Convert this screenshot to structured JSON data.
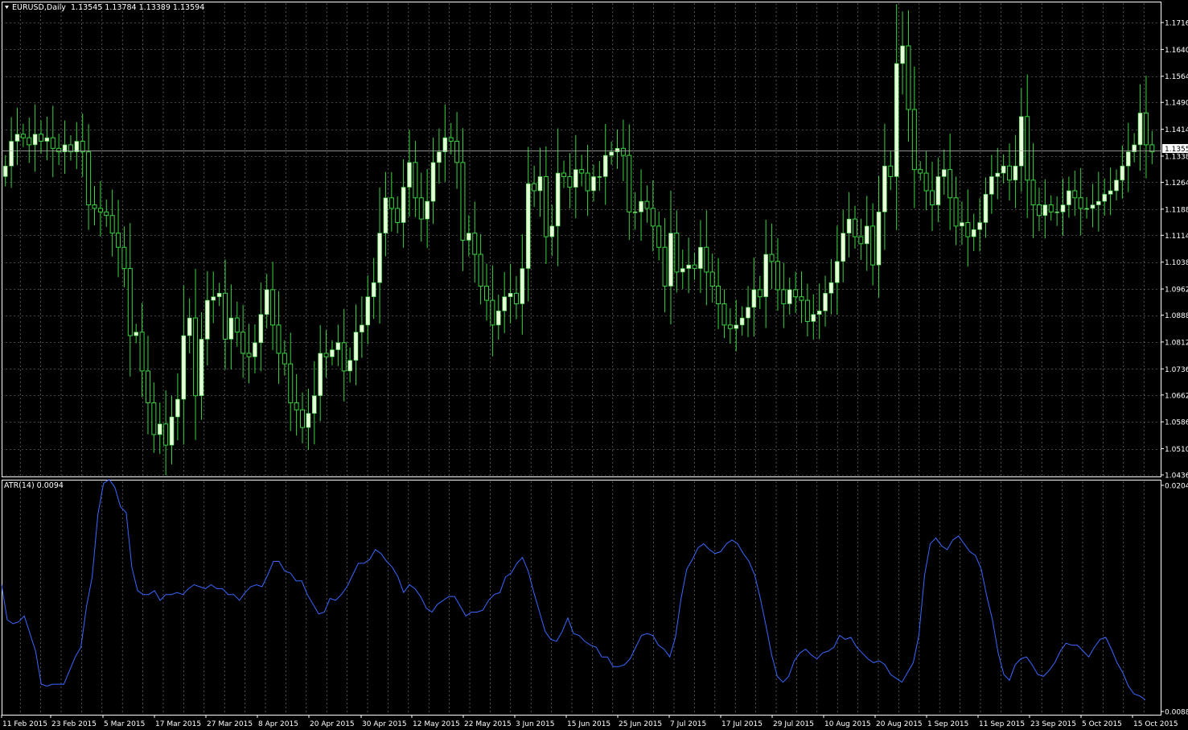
{
  "chart_data": [
    {
      "type": "candlestick",
      "symbol": "EURUSD,Daily",
      "ohlc_readout": "1.13545 1.13784 1.13389 1.13594",
      "current_price_label": "1.1355",
      "ylim": [
        1.0436,
        1.1716
      ],
      "price_ticks": [
        "1.1716",
        "1.1640",
        "1.1564",
        "1.1490",
        "1.1414",
        "1.1338",
        "1.1264",
        "1.1188",
        "1.1114",
        "1.1038",
        "1.0962",
        "1.0888",
        "1.0812",
        "1.0736",
        "1.0662",
        "1.0586",
        "1.0510",
        "1.0436"
      ],
      "close_series": [
        1.131,
        1.138,
        1.14,
        1.139,
        1.137,
        1.14,
        1.138,
        1.139,
        1.136,
        1.135,
        1.137,
        1.135,
        1.138,
        1.135,
        1.12,
        1.119,
        1.118,
        1.117,
        1.112,
        1.108,
        1.102,
        1.083,
        1.084,
        1.073,
        1.064,
        1.055,
        1.058,
        1.052,
        1.06,
        1.065,
        1.083,
        1.088,
        1.066,
        1.082,
        1.093,
        1.094,
        1.095,
        1.082,
        1.088,
        1.084,
        1.078,
        1.077,
        1.081,
        1.089,
        1.096,
        1.086,
        1.078,
        1.075,
        1.064,
        1.062,
        1.057,
        1.061,
        1.066,
        1.078,
        1.077,
        1.079,
        1.081,
        1.073,
        1.076,
        1.084,
        1.086,
        1.094,
        1.098,
        1.112,
        1.122,
        1.119,
        1.115,
        1.125,
        1.132,
        1.122,
        1.116,
        1.121,
        1.132,
        1.135,
        1.139,
        1.138,
        1.132,
        1.11,
        1.112,
        1.106,
        1.097,
        1.093,
        1.086,
        1.09,
        1.094,
        1.095,
        1.092,
        1.102,
        1.126,
        1.124,
        1.128,
        1.111,
        1.114,
        1.129,
        1.128,
        1.125,
        1.13,
        1.129,
        1.124,
        1.128,
        1.128,
        1.134,
        1.135,
        1.136,
        1.134,
        1.118,
        1.118,
        1.121,
        1.119,
        1.114,
        1.108,
        1.097,
        1.112,
        1.101,
        1.102,
        1.103,
        1.102,
        1.108,
        1.101,
        1.097,
        1.092,
        1.086,
        1.085,
        1.086,
        1.088,
        1.091,
        1.096,
        1.094,
        1.106,
        1.104,
        1.096,
        1.092,
        1.096,
        1.094,
        1.093,
        1.087,
        1.089,
        1.09,
        1.095,
        1.098,
        1.104,
        1.112,
        1.116,
        1.111,
        1.109,
        1.114,
        1.103,
        1.118,
        1.131,
        1.128,
        1.16,
        1.165,
        1.147,
        1.13,
        1.129,
        1.124,
        1.12,
        1.128,
        1.13,
        1.122,
        1.114,
        1.115,
        1.111,
        1.113,
        1.115,
        1.123,
        1.128,
        1.129,
        1.131,
        1.127,
        1.131,
        1.145,
        1.127,
        1.12,
        1.117,
        1.12,
        1.118,
        1.118,
        1.12,
        1.124,
        1.122,
        1.119,
        1.119,
        1.12,
        1.121,
        1.123,
        1.124,
        1.127,
        1.131,
        1.135,
        1.137,
        1.146,
        1.137,
        1.135
      ]
    },
    {
      "type": "line",
      "indicator": "ATR(14) 0.0094",
      "ylim": [
        0.0088,
        0.0204
      ],
      "ticks": [
        "0.0204",
        "0.0088"
      ],
      "values": [
        0.0153,
        0.0135,
        0.0133,
        0.0134,
        0.0137,
        0.0128,
        0.0119,
        0.0102,
        0.0101,
        0.0102,
        0.0102,
        0.0102,
        0.0109,
        0.0116,
        0.0121,
        0.0142,
        0.0157,
        0.0189,
        0.0205,
        0.0207,
        0.0203,
        0.0193,
        0.019,
        0.0162,
        0.015,
        0.0148,
        0.0148,
        0.015,
        0.0145,
        0.0148,
        0.0148,
        0.0149,
        0.0148,
        0.0151,
        0.0153,
        0.0152,
        0.0151,
        0.0153,
        0.0151,
        0.0151,
        0.0148,
        0.0148,
        0.0145,
        0.0149,
        0.0152,
        0.0153,
        0.0152,
        0.0158,
        0.0165,
        0.0165,
        0.016,
        0.0159,
        0.0155,
        0.0155,
        0.0148,
        0.0143,
        0.0138,
        0.0139,
        0.0146,
        0.0145,
        0.0148,
        0.0152,
        0.0158,
        0.0164,
        0.0164,
        0.0166,
        0.0171,
        0.0169,
        0.0165,
        0.0162,
        0.0157,
        0.0149,
        0.0153,
        0.0151,
        0.0147,
        0.0141,
        0.0139,
        0.0143,
        0.0145,
        0.0147,
        0.0147,
        0.0142,
        0.0137,
        0.0139,
        0.0139,
        0.014,
        0.0145,
        0.0148,
        0.0149,
        0.0157,
        0.0159,
        0.0164,
        0.0167,
        0.016,
        0.0149,
        0.0139,
        0.0129,
        0.0125,
        0.0124,
        0.0129,
        0.0136,
        0.0128,
        0.0127,
        0.0124,
        0.0122,
        0.0121,
        0.0116,
        0.0116,
        0.0111,
        0.0111,
        0.0112,
        0.0115,
        0.0121,
        0.0127,
        0.0128,
        0.0127,
        0.0122,
        0.012,
        0.0116,
        0.0126,
        0.0146,
        0.0161,
        0.0166,
        0.0172,
        0.0174,
        0.0171,
        0.0169,
        0.017,
        0.0174,
        0.0176,
        0.0174,
        0.0169,
        0.0165,
        0.0158,
        0.0146,
        0.0132,
        0.0117,
        0.0106,
        0.0103,
        0.0106,
        0.0114,
        0.0118,
        0.012,
        0.0117,
        0.0115,
        0.0118,
        0.0119,
        0.0121,
        0.0127,
        0.0125,
        0.0126,
        0.0121,
        0.0118,
        0.0115,
        0.0113,
        0.0114,
        0.0112,
        0.0107,
        0.0105,
        0.0103,
        0.0108,
        0.0113,
        0.0127,
        0.0158,
        0.0174,
        0.0177,
        0.0173,
        0.0171,
        0.0176,
        0.0178,
        0.0174,
        0.017,
        0.0168,
        0.0161,
        0.0147,
        0.0135,
        0.0118,
        0.0107,
        0.0104,
        0.0112,
        0.0115,
        0.0116,
        0.0112,
        0.0107,
        0.0106,
        0.0109,
        0.0113,
        0.0119,
        0.0123,
        0.0122,
        0.0122,
        0.0119,
        0.0116,
        0.0121,
        0.0125,
        0.0126,
        0.012,
        0.0113,
        0.0108,
        0.0101,
        0.0097,
        0.0096,
        0.0094
      ],
      "date_labels": [
        "11 Feb 2015",
        "23 Feb 2015",
        "5 Mar 2015",
        "17 Mar 2015",
        "27 Mar 2015",
        "8 Apr 2015",
        "20 Apr 2015",
        "30 Apr 2015",
        "12 May 2015",
        "22 May 2015",
        "3 Jun 2015",
        "15 Jun 2015",
        "25 Jun 2015",
        "7 Jul 2015",
        "17 Jul 2015",
        "29 Jul 2015",
        "10 Aug 2015",
        "20 Aug 2015",
        "1 Sep 2015",
        "11 Sep 2015",
        "23 Sep 2015",
        "5 Oct 2015",
        "15 Oct 2015"
      ]
    }
  ],
  "colors": {
    "background": "#000000",
    "grid": "#8a8a8a",
    "bull_body": "#e6ffd8",
    "wick": "#39d43f",
    "atr_line": "#3a66ff",
    "text": "#ffffff"
  }
}
